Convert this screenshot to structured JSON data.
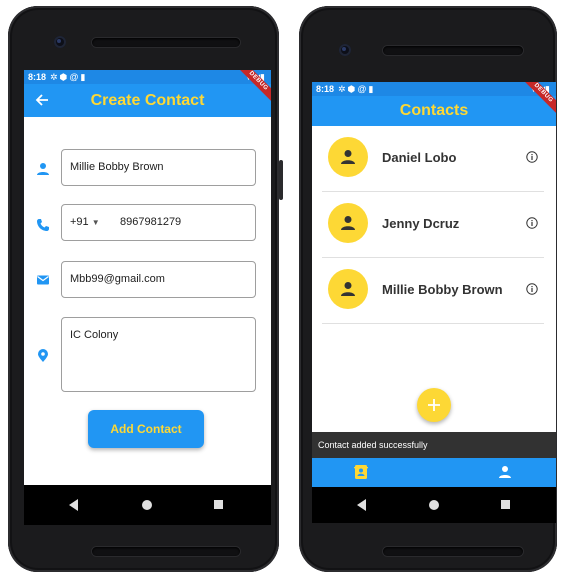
{
  "colors": {
    "appbar": "#2196f3",
    "statusbar": "#1e88e5",
    "accent_yellow": "#fdd835",
    "phone_body": "#1b1b1d",
    "snackbar": "#323232"
  },
  "left_screen": {
    "status_time": "8:18",
    "status_icons": [
      "gear-icon",
      "shield-icon",
      "at-icon",
      "sd-card-icon"
    ],
    "status_right": [
      "wifi-icon",
      "signal-icon",
      "battery-icon"
    ],
    "title": "Create Contact",
    "debug_banner": "DEBUG",
    "form": {
      "name": {
        "icon": "person-icon",
        "value": "Millie Bobby Brown"
      },
      "phone": {
        "icon": "phone-icon",
        "country_code": "+91",
        "value": "8967981279"
      },
      "email": {
        "icon": "mail-icon",
        "value": "Mbb99@gmail.com"
      },
      "address": {
        "icon": "location-pin-icon",
        "value": "IC Colony"
      }
    },
    "submit_label": "Add Contact"
  },
  "right_screen": {
    "status_time": "8:18",
    "status_icons": [
      "gear-icon",
      "shield-icon",
      "at-icon",
      "sd-card-icon"
    ],
    "title": "Contacts",
    "debug_banner": "DEBUG",
    "contacts": [
      {
        "name": "Daniel Lobo"
      },
      {
        "name": "Jenny Dcruz"
      },
      {
        "name": "Millie Bobby Brown"
      }
    ],
    "fab_icon": "plus-icon",
    "snackbar_text": "Contact added successfully",
    "bottom_nav": [
      {
        "icon": "contacts-book-icon",
        "selected": true
      },
      {
        "icon": "person-icon",
        "selected": false
      }
    ]
  }
}
